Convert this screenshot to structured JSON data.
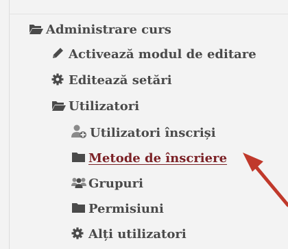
{
  "nav": {
    "root": {
      "label": "Administrare curs",
      "icon": "folder-open-icon"
    },
    "items": [
      {
        "label": "Activează modul de editare",
        "icon": "pencil-icon"
      },
      {
        "label": "Editează setări",
        "icon": "gear-icon"
      },
      {
        "label": "Utilizatori",
        "icon": "folder-open-icon"
      },
      {
        "label": "Utilizatori înscriși",
        "icon": "user-add-icon"
      },
      {
        "label": "Metode de înscriere",
        "icon": "folder-icon"
      },
      {
        "label": "Grupuri",
        "icon": "users-icon"
      },
      {
        "label": "Permisiuni",
        "icon": "folder-icon"
      },
      {
        "label": "Alți utilizatori",
        "icon": "gear-icon"
      }
    ]
  },
  "colors": {
    "text": "#4a4a4a",
    "link": "#7b2126",
    "arrow": "#c0392b"
  }
}
